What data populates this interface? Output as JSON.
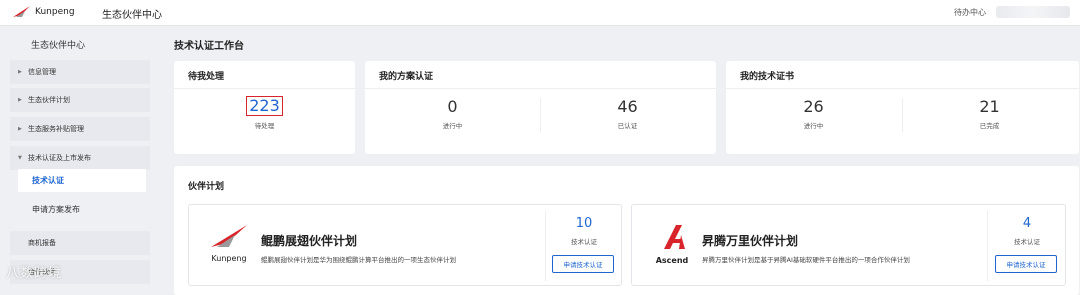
{
  "topbar": {
    "logo_text": "Kunpeng",
    "title": "生态伙伴中心",
    "todo": "待办中心"
  },
  "sidebar": {
    "title": "生态伙伴中心",
    "items": [
      {
        "label": "信息管理"
      },
      {
        "label": "生态伙伴计划"
      },
      {
        "label": "生态服务补贴管理"
      },
      {
        "label": "技术认证及上市发布"
      }
    ],
    "subitems": [
      {
        "label": "技术认证"
      },
      {
        "label": "申请方案发布"
      }
    ],
    "extra": {
      "label": "商机报备"
    },
    "partial": {
      "label": "合作伙伴"
    }
  },
  "main": {
    "title": "技术认证工作台",
    "pending": {
      "title": "待我处理",
      "count": "223",
      "label": "待处理"
    },
    "solution": {
      "title": "我的方案认证",
      "stats": [
        {
          "value": "0",
          "label": "进行中"
        },
        {
          "value": "46",
          "label": "已认证"
        }
      ]
    },
    "certs": {
      "title": "我的技术证书",
      "stats": [
        {
          "value": "26",
          "label": "进行中"
        },
        {
          "value": "21",
          "label": "已完成"
        }
      ]
    },
    "partner_plans": {
      "title": "伙伴计划",
      "plans": [
        {
          "logo_text": "Kunpeng",
          "name": "鲲鹏展翅伙伴计划",
          "desc": "鲲鹏展翅伙伴计划是华为围绕鲲鹏计算平台推出的一项生态伙伴计划",
          "count": "10",
          "count_label": "技术认证",
          "button": "申请技术认证"
        },
        {
          "logo_text": "Ascend",
          "name": "昇腾万里伙伴计划",
          "desc": "昇腾万里伙伴计划是基于昇腾AI基础软硬件平台推出的一项合作伙伴计划",
          "count": "4",
          "count_label": "技术认证",
          "button": "申请技术认证"
        }
      ]
    }
  },
  "watermark": "八数跨境",
  "colors": {
    "accent": "#1f66d0",
    "highlight_border": "#d8252b",
    "bg": "#eef0f4"
  }
}
